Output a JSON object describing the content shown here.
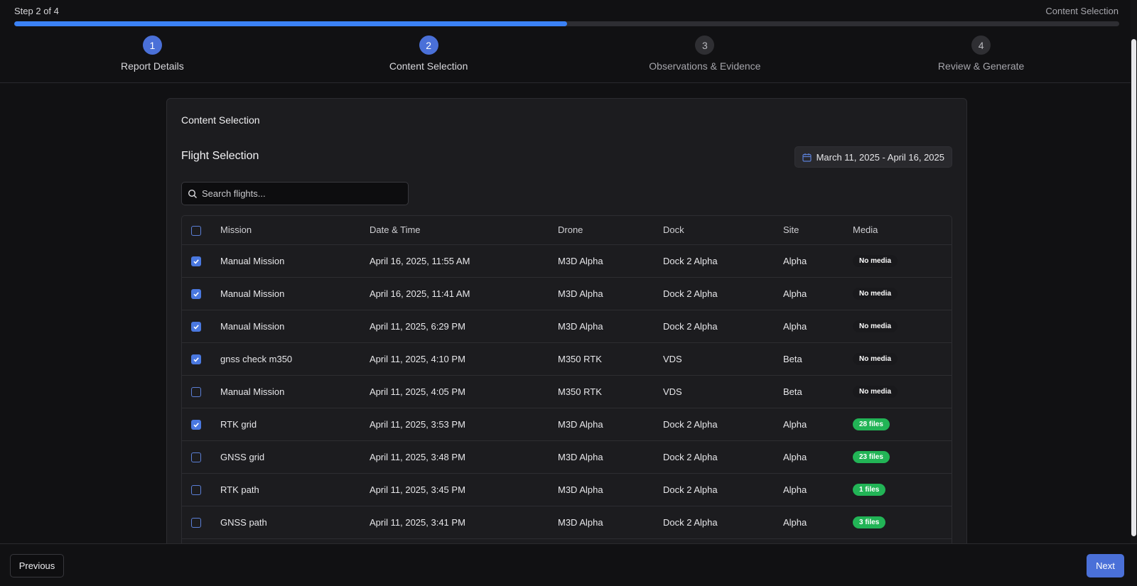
{
  "header": {
    "step_text": "Step 2 of 4",
    "current_step_name": "Content Selection",
    "progress_fraction": 0.5,
    "accent_color": "#3b82f6",
    "steps": [
      {
        "number": "1",
        "label": "Report Details",
        "state": "done"
      },
      {
        "number": "2",
        "label": "Content Selection",
        "state": "active"
      },
      {
        "number": "3",
        "label": "Observations & Evidence",
        "state": "upcoming"
      },
      {
        "number": "4",
        "label": "Review & Generate",
        "state": "upcoming"
      }
    ]
  },
  "card": {
    "title": "Content Selection",
    "section_title": "Flight Selection",
    "date_range": "March 11, 2025 - April 16, 2025",
    "date_icon": "calendar-icon",
    "search": {
      "placeholder": "Search flights...",
      "value": "",
      "icon": "search-icon"
    }
  },
  "table": {
    "columns": [
      "Mission",
      "Date & Time",
      "Drone",
      "Dock",
      "Site",
      "Media"
    ],
    "select_all_checked": false,
    "rows": [
      {
        "checked": true,
        "mission": "Manual Mission",
        "datetime": "April 16, 2025, 11:55 AM",
        "drone": "M3D Alpha",
        "dock": "Dock 2 Alpha",
        "site": "Alpha",
        "media": "No media",
        "has_media": false
      },
      {
        "checked": true,
        "mission": "Manual Mission",
        "datetime": "April 16, 2025, 11:41 AM",
        "drone": "M3D Alpha",
        "dock": "Dock 2 Alpha",
        "site": "Alpha",
        "media": "No media",
        "has_media": false
      },
      {
        "checked": true,
        "mission": "Manual Mission",
        "datetime": "April 11, 2025, 6:29 PM",
        "drone": "M3D Alpha",
        "dock": "Dock 2 Alpha",
        "site": "Alpha",
        "media": "No media",
        "has_media": false
      },
      {
        "checked": true,
        "mission": "gnss check m350",
        "datetime": "April 11, 2025, 4:10 PM",
        "drone": "M350 RTK",
        "dock": "VDS",
        "site": "Beta",
        "media": "No media",
        "has_media": false
      },
      {
        "checked": false,
        "mission": "Manual Mission",
        "datetime": "April 11, 2025, 4:05 PM",
        "drone": "M350 RTK",
        "dock": "VDS",
        "site": "Beta",
        "media": "No media",
        "has_media": false
      },
      {
        "checked": true,
        "mission": "RTK grid",
        "datetime": "April 11, 2025, 3:53 PM",
        "drone": "M3D Alpha",
        "dock": "Dock 2 Alpha",
        "site": "Alpha",
        "media": "28 files",
        "has_media": true
      },
      {
        "checked": false,
        "mission": "GNSS grid",
        "datetime": "April 11, 2025, 3:48 PM",
        "drone": "M3D Alpha",
        "dock": "Dock 2 Alpha",
        "site": "Alpha",
        "media": "23 files",
        "has_media": true
      },
      {
        "checked": false,
        "mission": "RTK path",
        "datetime": "April 11, 2025, 3:45 PM",
        "drone": "M3D Alpha",
        "dock": "Dock 2 Alpha",
        "site": "Alpha",
        "media": "1 files",
        "has_media": true
      },
      {
        "checked": false,
        "mission": "GNSS path",
        "datetime": "April 11, 2025, 3:41 PM",
        "drone": "M3D Alpha",
        "dock": "Dock 2 Alpha",
        "site": "Alpha",
        "media": "3 files",
        "has_media": true
      }
    ]
  },
  "footer": {
    "previous_label": "Previous",
    "next_label": "Next"
  }
}
